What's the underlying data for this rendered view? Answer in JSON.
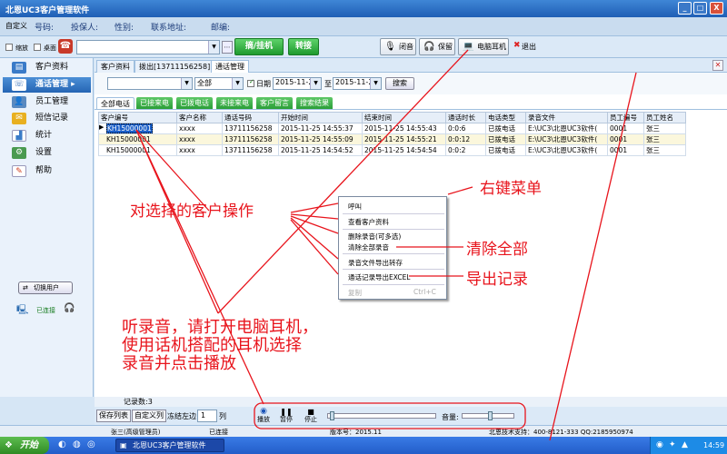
{
  "window": {
    "title": "北恩UC3客户管理软件",
    "min": "_",
    "max": "□",
    "close": "X"
  },
  "infobar": {
    "custom": "自定义",
    "number": "号码:",
    "insurer": "投保人:",
    "gender": "性别:",
    "address": "联系地址:",
    "zip": "邮编:"
  },
  "toolbar": {
    "shrink": "缩放",
    "desktop": "桌面",
    "dial_value": "",
    "hang_label": "摘/挂机",
    "transfer_label": "转接",
    "mute_label": "闭音",
    "hold_label": "保留",
    "headset_label": "电脑耳机",
    "exit_label": "退出"
  },
  "sidebar": {
    "items": [
      {
        "label": "客户资料",
        "icon": "address-book-icon"
      },
      {
        "label": "通话管理",
        "icon": "phone-icon",
        "arrow": "▸"
      },
      {
        "label": "员工管理",
        "icon": "staff-icon"
      },
      {
        "label": "短信记录",
        "icon": "envelope-icon"
      },
      {
        "label": "统计",
        "icon": "bar-chart-icon"
      },
      {
        "label": "设置",
        "icon": "settings-icon"
      },
      {
        "label": "帮助",
        "icon": "help-icon"
      }
    ],
    "switch_user": "切换用户",
    "connected": "已连接"
  },
  "tabs": [
    "客户资料",
    "拨出[13711156258]",
    "通话管理"
  ],
  "filter": {
    "combo1": "",
    "combo2": "全部",
    "date_checkbox": "日期",
    "date_from": "2015-11-22",
    "to": "至",
    "date_to": "2015-11-25",
    "search": "搜索"
  },
  "subtabs": [
    "全部电话",
    "已接来电",
    "已拨电话",
    "未接来电",
    "客户留言",
    "搜索结果"
  ],
  "table": {
    "columns": [
      "客户编号",
      "客户名称",
      "通话号码",
      "开始时间",
      "结束时间",
      "通话时长",
      "电话类型",
      "录音文件",
      "员工编号",
      "员工姓名"
    ],
    "rows": [
      [
        "KH15000001",
        "xxxx",
        "13711156258",
        "2015-11-25 14:55:37",
        "2015-11-25 14:55:43",
        "0:0:6",
        "已拨电话",
        "E:\\UC3\\北恩UC3软件(",
        "0001",
        "张三"
      ],
      [
        "KH15000001",
        "xxxx",
        "13711156258",
        "2015-11-25 14:55:09",
        "2015-11-25 14:55:21",
        "0:0:12",
        "已拨电话",
        "E:\\UC3\\北恩UC3软件(",
        "0001",
        "张三"
      ],
      [
        "KH15000001",
        "xxxx",
        "13711156258",
        "2015-11-25 14:54:52",
        "2015-11-25 14:54:54",
        "0:0:2",
        "已拨电话",
        "E:\\UC3\\北恩UC3软件(",
        "0001",
        "张三"
      ]
    ]
  },
  "menu": {
    "items": [
      "呼叫",
      "查看客户资料",
      "删除录音(可多选)",
      "清除全部录音",
      "录音文件导出转存",
      "通话记录导出EXCEL",
      "复制"
    ],
    "copy_shortcut": "Ctrl+C"
  },
  "annotations": {
    "right_menu": "右键菜单",
    "operate": "对选择的客户操作",
    "clear_all": "清除全部",
    "export": "导出记录",
    "listen_line1": "听录音，请打开电脑耳机，",
    "listen_line2": "使用话机搭配的耳机选择",
    "listen_line3": "录音并点击播放"
  },
  "footer": {
    "count": "记录数:3",
    "save_list": "保存列表",
    "custom_list": "自定义列",
    "freeze": "冻结左边",
    "freeze_value": "1",
    "col": "列",
    "play": "播放",
    "pause": "暂停",
    "stop": "停止",
    "volume": "音量:"
  },
  "statusbar": {
    "user": "张三(高级管理员)",
    "state": "已连接",
    "version": "版本号：2015.11",
    "support": "北恩技术支持：400-8121-333 QQ:2185950974"
  },
  "taskbar": {
    "start": "开始",
    "task": "北恩UC3客户管理软件",
    "time": "14:59"
  },
  "colors": {
    "titlebar": "#2f6fc4",
    "accent_green": "#2a9e37",
    "annotation_red": "#e8141c"
  }
}
